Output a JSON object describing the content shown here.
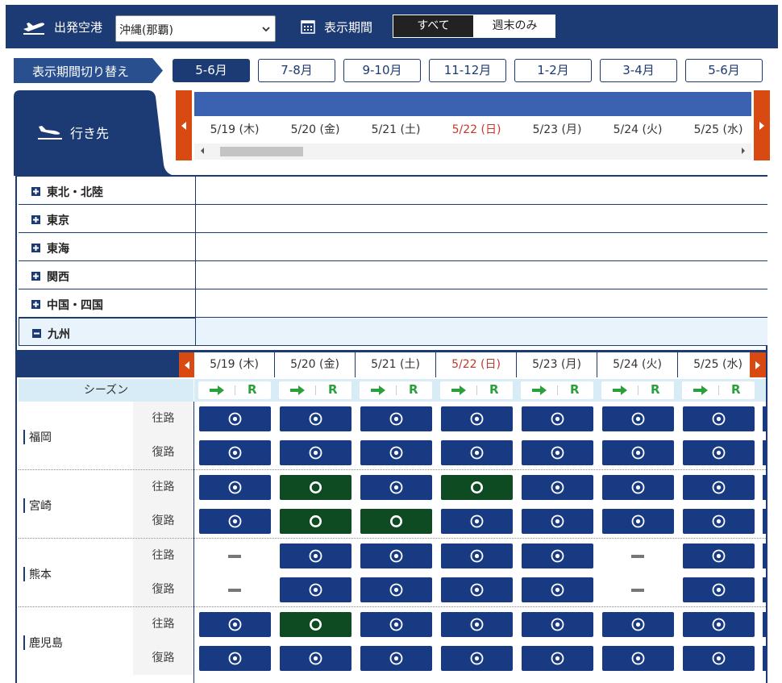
{
  "header": {
    "departure_label": "出発空港",
    "departure_value": "沖縄(那覇)",
    "period_label": "表示期間",
    "toggle_all": "すべて",
    "toggle_weekend": "週末のみ"
  },
  "period_switch": {
    "label": "表示期間切り替え",
    "tabs": [
      "5-6月",
      "7-8月",
      "9-10月",
      "11-12月",
      "1-2月",
      "3-4月",
      "5-6月"
    ],
    "active_index": 0
  },
  "destinations_header": "行き先",
  "dates": [
    "5/19 (木)",
    "5/20 (金)",
    "5/21 (土)",
    "5/22 (日)",
    "5/23 (月)",
    "5/24 (火)",
    "5/25 (水)"
  ],
  "sunday_index": 3,
  "regions": [
    "東北・北陸",
    "東京",
    "東海",
    "関西",
    "中国・四国",
    "九州"
  ],
  "open_region_index": 5,
  "season_label": "シーズン",
  "season_symbol": "R",
  "direction_labels": {
    "outbound": "往路",
    "return": "復路"
  },
  "cities": [
    {
      "name": "福岡",
      "outbound": [
        "blue",
        "blue",
        "blue",
        "blue",
        "blue",
        "blue",
        "blue"
      ],
      "return": [
        "blue",
        "blue",
        "blue",
        "blue",
        "blue",
        "blue",
        "blue"
      ]
    },
    {
      "name": "宮崎",
      "outbound": [
        "blue",
        "green",
        "blue",
        "green",
        "blue",
        "blue",
        "blue"
      ],
      "return": [
        "blue",
        "green",
        "green",
        "blue",
        "blue",
        "blue",
        "blue"
      ]
    },
    {
      "name": "熊本",
      "outbound": [
        "none",
        "blue",
        "blue",
        "blue",
        "blue",
        "none",
        "blue"
      ],
      "return": [
        "none",
        "blue",
        "blue",
        "blue",
        "blue",
        "none",
        "blue"
      ]
    },
    {
      "name": "鹿児島",
      "outbound": [
        "blue",
        "green",
        "blue",
        "blue",
        "blue",
        "blue",
        "blue"
      ],
      "return": [
        "blue",
        "blue",
        "blue",
        "blue",
        "blue",
        "blue",
        "blue"
      ]
    }
  ],
  "colors": {
    "navy": "#1c3a73",
    "cell_blue": "#173a82",
    "cell_green": "#0e4a22",
    "accent_orange": "#d84a12",
    "sunday_red": "#c0392b"
  },
  "icons": {
    "departure": "plane-takeoff-icon",
    "calendar": "calendar-icon",
    "landing": "plane-landing-icon"
  }
}
